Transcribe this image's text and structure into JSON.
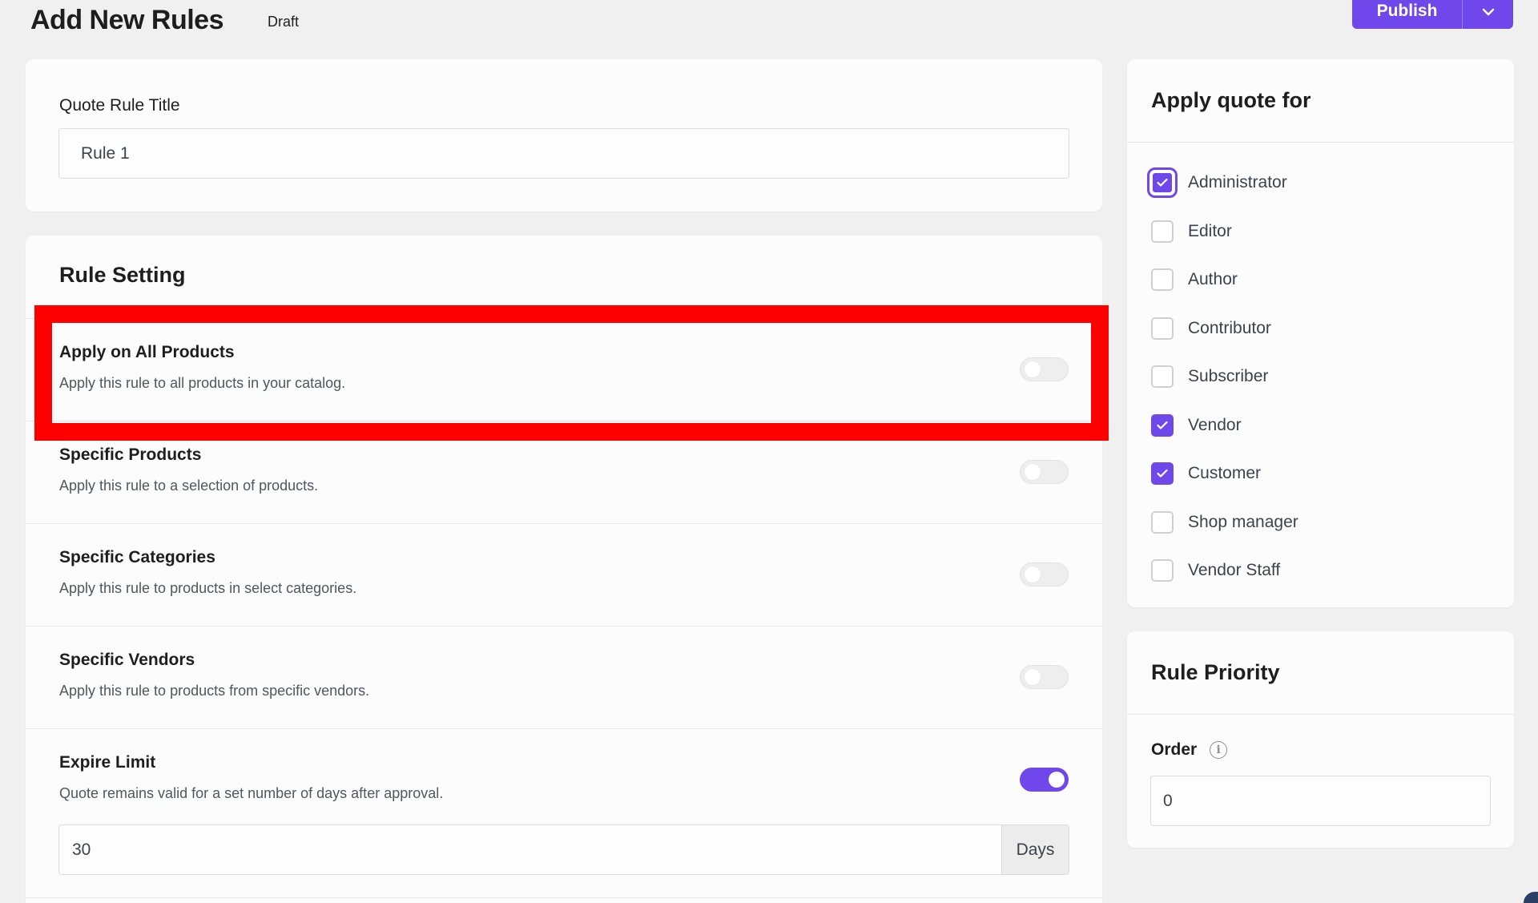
{
  "header": {
    "title": "Add New Rules",
    "status": "Draft",
    "publish_label": "Publish",
    "publish_toggle_icon": "chevron-down-icon"
  },
  "quote_title": {
    "label": "Quote Rule Title",
    "value": "Rule 1"
  },
  "rule_setting": {
    "heading": "Rule Setting",
    "rules": [
      {
        "title": "Apply on All Products",
        "description": "Apply this rule to all products in your catalog.",
        "enabled": false
      },
      {
        "title": "Specific Products",
        "description": "Apply this rule to a selection of products.",
        "enabled": false
      },
      {
        "title": "Specific Categories",
        "description": "Apply this rule to products in select categories.",
        "enabled": false
      },
      {
        "title": "Specific Vendors",
        "description": "Apply this rule to products from specific vendors.",
        "enabled": false
      },
      {
        "title": "Expire Limit",
        "description": "Quote remains valid for a set number of days after approval.",
        "enabled": true
      }
    ],
    "expire_days_value": "30",
    "expire_days_suffix": "Days"
  },
  "apply_quote_for": {
    "heading": "Apply quote for",
    "roles": [
      {
        "label": "Administrator",
        "checked": true
      },
      {
        "label": "Editor",
        "checked": false
      },
      {
        "label": "Author",
        "checked": false
      },
      {
        "label": "Contributor",
        "checked": false
      },
      {
        "label": "Subscriber",
        "checked": false
      },
      {
        "label": "Vendor",
        "checked": true
      },
      {
        "label": "Customer",
        "checked": true
      },
      {
        "label": "Shop manager",
        "checked": false
      },
      {
        "label": "Vendor Staff",
        "checked": false
      }
    ]
  },
  "rule_priority": {
    "heading": "Rule Priority",
    "order_label": "Order",
    "order_value": "0",
    "info_icon": "info-icon"
  },
  "colors": {
    "accent": "#7047eb",
    "highlight": "#ff0000"
  }
}
